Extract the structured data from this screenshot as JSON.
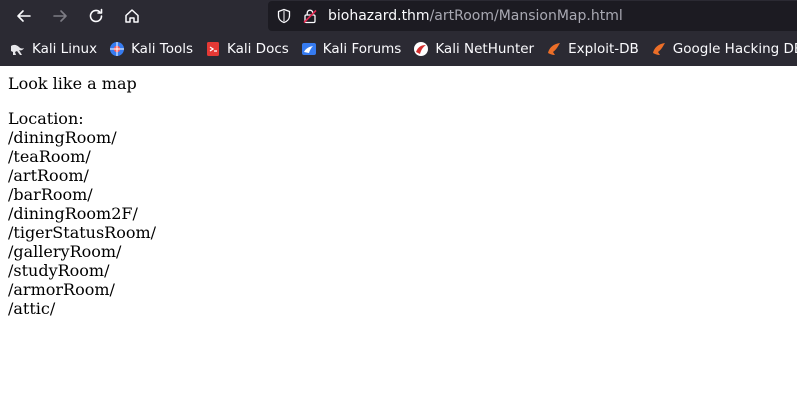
{
  "browser": {
    "url_host": "biohazard.thm",
    "url_path": "/artRoom/MansionMap.html",
    "bookmarks": [
      {
        "label": "Kali Linux",
        "icon": "kali-dragon-icon"
      },
      {
        "label": "Kali Tools",
        "icon": "kali-tools-icon"
      },
      {
        "label": "Kali Docs",
        "icon": "kali-docs-icon"
      },
      {
        "label": "Kali Forums",
        "icon": "kali-forums-icon"
      },
      {
        "label": "Kali NetHunter",
        "icon": "kali-nethunter-icon"
      },
      {
        "label": "Exploit-DB",
        "icon": "exploit-db-icon"
      },
      {
        "label": "Google Hacking DB",
        "icon": "ghdb-icon"
      }
    ]
  },
  "page": {
    "heading": "Look like a map",
    "location_label": "Location:",
    "locations": [
      "/diningRoom/",
      "/teaRoom/",
      "/artRoom/",
      "/barRoom/",
      "/diningRoom2F/",
      "/tigerStatusRoom/",
      "/galleryRoom/",
      "/studyRoom/",
      "/armorRoom/",
      "/attic/"
    ]
  },
  "colors": {
    "chrome_bg": "#2b2a33",
    "urlbar_bg": "#1c1b22",
    "text_light": "#fbfbfe",
    "text_dim": "#a9a9b3"
  }
}
